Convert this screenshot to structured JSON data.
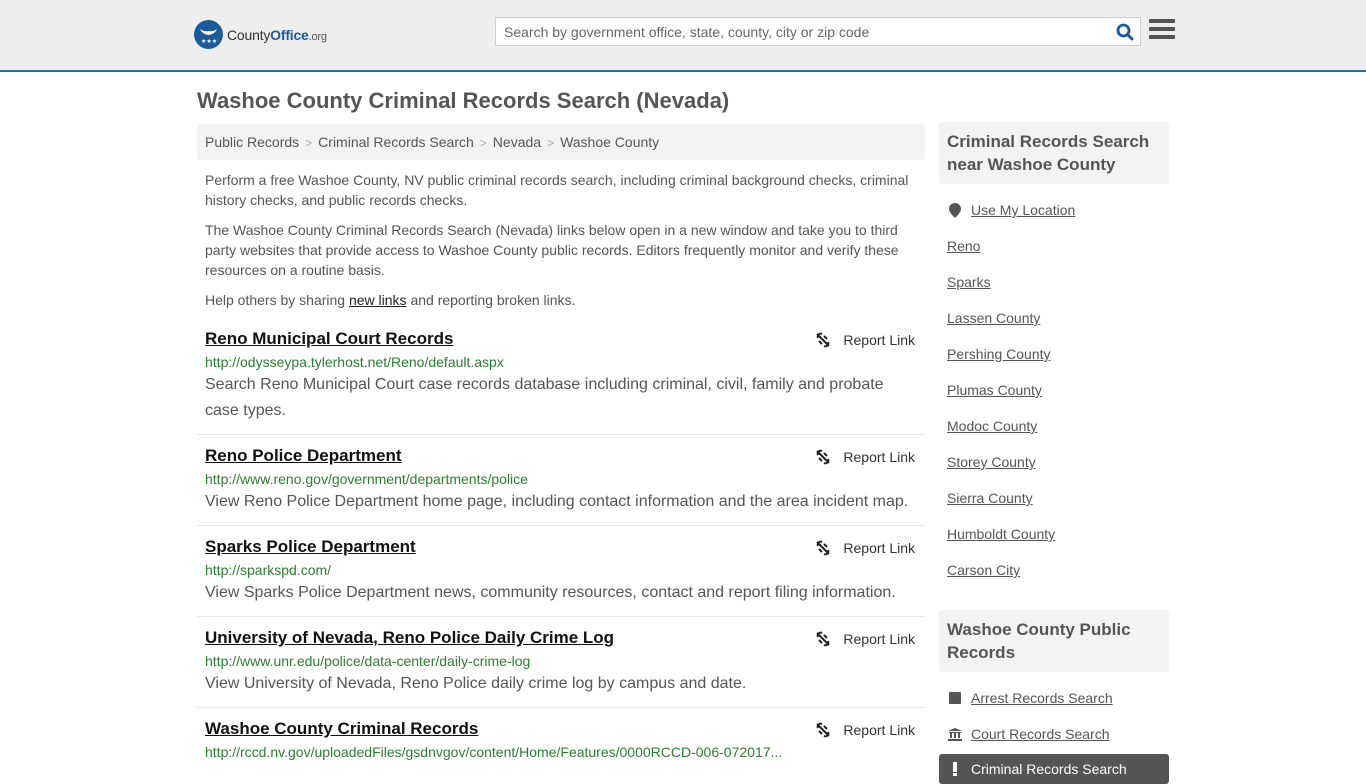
{
  "header": {
    "logo": {
      "part1": "County",
      "part2": "Office",
      "part3": ".org"
    },
    "search_placeholder": "Search by government office, state, county, city or zip code",
    "search_value": "",
    "accent_color": "#1d5a9c"
  },
  "page_title": "Washoe County Criminal Records Search (Nevada)",
  "breadcrumb": [
    "Public Records",
    "Criminal Records Search",
    "Nevada",
    "Washoe County"
  ],
  "intro": {
    "p1": "Perform a free Washoe County, NV public criminal records search, including criminal background checks, criminal history checks, and public records checks.",
    "p2": "The Washoe County Criminal Records Search (Nevada) links below open in a new window and take you to third party websites that provide access to Washoe County public records. Editors frequently monitor and verify these resources on a routine basis.",
    "p3_before": "Help others by sharing ",
    "p3_link": "new links",
    "p3_after": " and reporting broken links."
  },
  "report_label": "Report Link",
  "records": [
    {
      "title": "Reno Municipal Court Records",
      "url": "http://odysseypa.tylerhost.net/Reno/default.aspx",
      "desc": "Search Reno Municipal Court case records database including criminal, civil, family and probate case types."
    },
    {
      "title": "Reno Police Department",
      "url": "http://www.reno.gov/government/departments/police",
      "desc": "View Reno Police Department home page, including contact information and the area incident map."
    },
    {
      "title": "Sparks Police Department",
      "url": "http://sparkspd.com/",
      "desc": "View Sparks Police Department news, community resources, contact and report filing information."
    },
    {
      "title": "University of Nevada, Reno Police Daily Crime Log",
      "url": "http://www.unr.edu/police/data-center/daily-crime-log",
      "desc": "View University of Nevada, Reno Police daily crime log by campus and date."
    },
    {
      "title": "Washoe County Criminal Records",
      "url": "http://rccd.nv.gov/uploadedFiles/gsdnvgov/content/Home/Features/0000RCCD-006-072017...",
      "desc": ""
    }
  ],
  "sidebar": {
    "nearby_heading": "Criminal Records Search near Washoe County",
    "use_location": "Use My Location",
    "nearby": [
      "Reno",
      "Sparks",
      "Lassen County",
      "Pershing County",
      "Plumas County",
      "Modoc County",
      "Storey County",
      "Sierra County",
      "Humboldt County",
      "Carson City"
    ],
    "public_heading": "Washoe County Public Records",
    "public_items": [
      {
        "label": "Arrest Records Search",
        "icon": "square-icon"
      },
      {
        "label": "Court Records Search",
        "icon": "courthouse-icon"
      },
      {
        "label": "Criminal Records Search",
        "icon": "exclamation-icon",
        "active": true
      }
    ]
  }
}
